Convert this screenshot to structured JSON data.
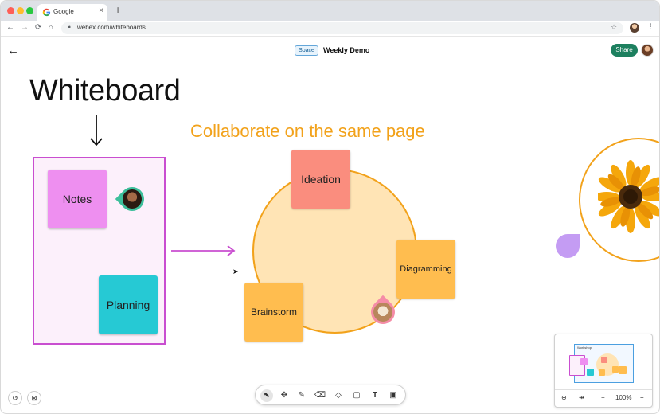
{
  "browser": {
    "tab_title": "Google",
    "tab_close": "×",
    "new_tab": "+",
    "url": "webex.com/whiteboards",
    "nav": {
      "back": "←",
      "forward": "→",
      "reload": "⟳",
      "home": "⌂"
    }
  },
  "header": {
    "back": "←",
    "space_badge": "Space",
    "meeting_title": "Weekly Demo",
    "share_label": "Share"
  },
  "canvas": {
    "title": "Whiteboard",
    "down_arrow": "↓",
    "collab_text": "Collaborate on the same page",
    "stickies": {
      "notes": "Notes",
      "planning": "Planning",
      "ideation": "Ideation",
      "diagramming": "Diagramming",
      "brainstorm": "Brainstorm"
    },
    "accent_colors": {
      "frame": "#c94ed0",
      "orange": "#f2a21b",
      "notes": "#ee8ff0",
      "planning": "#26c9d4",
      "ideation": "#fa8d7e",
      "yellow": "#ffbd4f",
      "purple": "#c49cf3",
      "share": "#1d805f"
    }
  },
  "toolbar": {
    "tools": [
      {
        "name": "select-tool-icon",
        "glyph": "⬉",
        "active": true
      },
      {
        "name": "move-tool-icon",
        "glyph": "✥",
        "active": false
      },
      {
        "name": "pen-tool-icon",
        "glyph": "✎",
        "active": false
      },
      {
        "name": "eraser-tool-icon",
        "glyph": "⌫",
        "active": false
      },
      {
        "name": "shapes-tool-icon",
        "glyph": "◇",
        "active": false
      },
      {
        "name": "sticky-note-tool-icon",
        "glyph": "▢",
        "active": false
      },
      {
        "name": "text-tool-icon",
        "glyph": "T",
        "active": false
      },
      {
        "name": "image-tool-icon",
        "glyph": "▣",
        "active": false
      }
    ],
    "left_buttons": [
      {
        "name": "undo-icon",
        "glyph": "↺"
      },
      {
        "name": "grid-icon",
        "glyph": "⊠"
      }
    ]
  },
  "minimap": {
    "label": "Workshop",
    "zoom_level": "100%",
    "zoom_out": "−",
    "zoom_in": "+",
    "fit": "⊖",
    "width_fit": "⇹"
  }
}
